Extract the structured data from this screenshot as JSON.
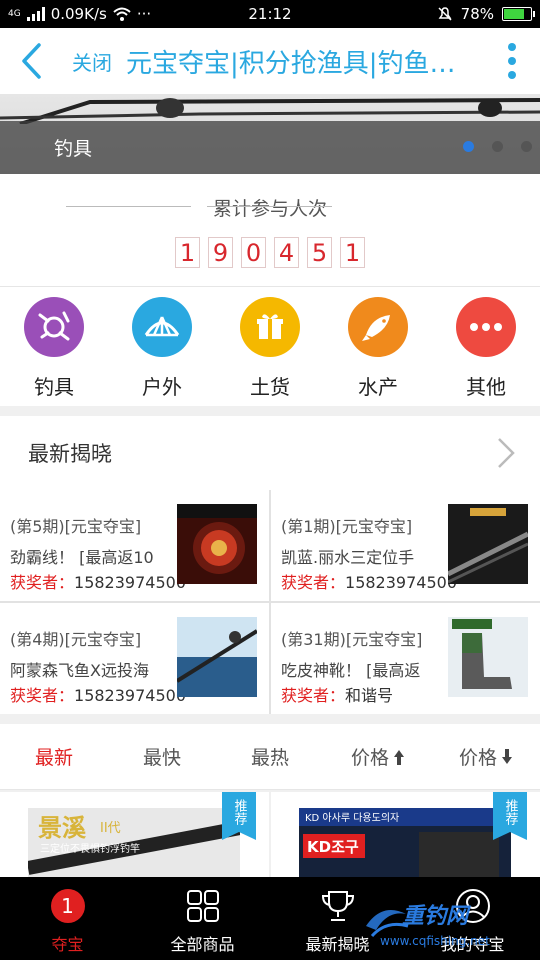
{
  "status_bar": {
    "network_type": "4G",
    "speed": "0.09K/s",
    "more": "···",
    "time": "21:12",
    "battery_percent": "78%",
    "battery_level": 0.78
  },
  "nav": {
    "close_label": "关闭",
    "title": "元宝夺宝|积分抢渔具|钓鱼人..."
  },
  "banner": {
    "caption": "钓具",
    "active_slide": 0,
    "slide_count": 3
  },
  "participants": {
    "title": "累计参与人次",
    "digits": [
      "1",
      "9",
      "0",
      "4",
      "5",
      "1"
    ]
  },
  "categories": [
    {
      "label": "钓具",
      "icon": "fishing-reel-icon",
      "color": "#9a4fb8"
    },
    {
      "label": "户外",
      "icon": "tent-icon",
      "color": "#2aa8e0"
    },
    {
      "label": "土货",
      "icon": "gift-box-icon",
      "color": "#f5b800"
    },
    {
      "label": "水产",
      "icon": "fish-icon",
      "color": "#f08a1c"
    },
    {
      "label": "其他",
      "icon": "more-dots-icon",
      "color": "#ee4a40"
    }
  ],
  "latest_reveal": {
    "title": "最新揭晓",
    "winner_label": "获奖者：",
    "items": [
      {
        "period": "(第5期)[元宝夺宝]",
        "desc": "劲霸线！ [最高返10",
        "winner": "15823974500"
      },
      {
        "period": "(第1期)[元宝夺宝]",
        "desc": "凯蓝.丽水三定位手",
        "winner": "15823974500"
      },
      {
        "period": "(第4期)[元宝夺宝]",
        "desc": "阿蒙森飞鱼X远投海",
        "winner": "15823974500"
      },
      {
        "period": "(第31期)[元宝夺宝]",
        "desc": "吃皮神靴！ [最高返",
        "winner": "和谐号"
      }
    ]
  },
  "sort_tabs": [
    {
      "label": "最新",
      "active": true
    },
    {
      "label": "最快",
      "active": false
    },
    {
      "label": "最热",
      "active": false
    },
    {
      "label": "价格",
      "arrow": "up",
      "active": false
    },
    {
      "label": "价格",
      "arrow": "down",
      "active": false
    }
  ],
  "products": {
    "badge": "推荐",
    "items": [
      {
        "title_text": "景溪",
        "sub_text": "II代",
        "line_text": "三定位不畏惧钓浮钓竿"
      },
      {
        "header_text": "KD 아사루 다용도의자",
        "brand_text": "KD조구"
      }
    ]
  },
  "tabbar": [
    {
      "label": "夺宝",
      "icon": "home-badge-icon",
      "badge": "1",
      "active": true
    },
    {
      "label": "全部商品",
      "icon": "grid-icon",
      "active": false
    },
    {
      "label": "最新揭晓",
      "icon": "trophy-icon",
      "active": false
    },
    {
      "label": "我的夺宝",
      "icon": "user-icon",
      "active": false
    }
  ],
  "watermark": {
    "text": "重钓网",
    "url": "www.cqfishing.net"
  }
}
